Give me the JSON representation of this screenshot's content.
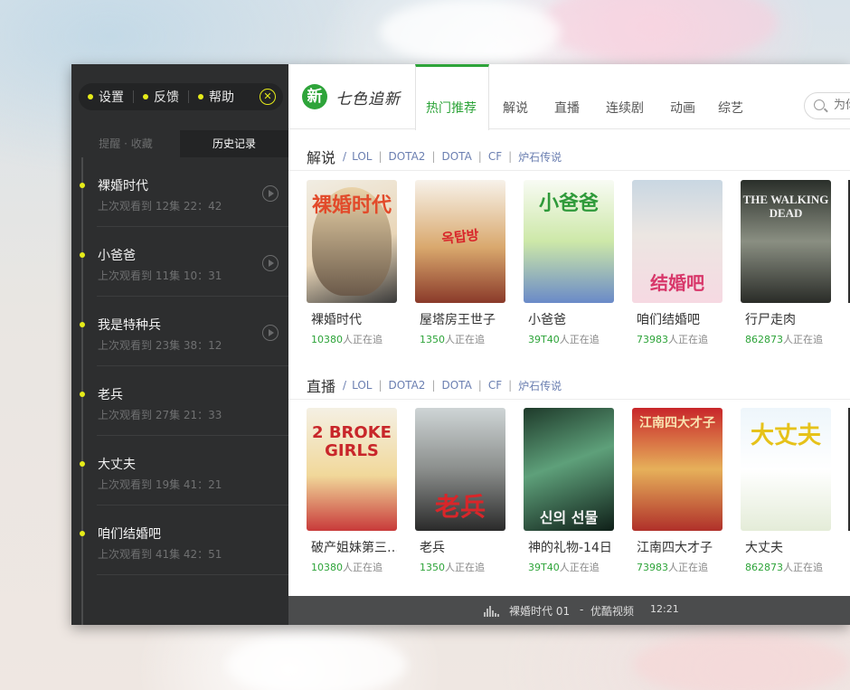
{
  "sidebar": {
    "top_links": [
      {
        "label": "设置"
      },
      {
        "label": "反馈"
      },
      {
        "label": "帮助"
      }
    ],
    "tabs": [
      {
        "label": "提醒 · 收藏"
      },
      {
        "label": "历史记录"
      }
    ],
    "history": [
      {
        "title": "裸婚时代",
        "sub": "上次观看到 12集 22：42"
      },
      {
        "title": "小爸爸",
        "sub": "上次观看到 11集 10：31"
      },
      {
        "title": "我是特种兵",
        "sub": "上次观看到 23集 38：12"
      },
      {
        "title": "老兵",
        "sub": "上次观看到 27集 21：33"
      },
      {
        "title": "大丈夫",
        "sub": "上次观看到 19集 41：21"
      },
      {
        "title": "咱们结婚吧",
        "sub": "上次观看到 41集 42：51"
      }
    ]
  },
  "header": {
    "logo_badge": "新",
    "logo_text": "七色追新",
    "nav": [
      "热门推荐",
      "解说",
      "直播",
      "连续剧",
      "动画",
      "综艺"
    ],
    "search_placeholder": "为你"
  },
  "sections": [
    {
      "title": "解说",
      "slash": "/",
      "links": [
        "LOL",
        "DOTA2",
        "DOTA",
        "CF",
        "炉石传说"
      ],
      "cards": [
        {
          "title": "裸婚时代",
          "count": "10380",
          "suffix": "人正在追",
          "poster_text": "裸婚时代"
        },
        {
          "title": "屋塔房王世子",
          "count": "1350",
          "suffix": "人正在追",
          "poster_text": "옥탑방"
        },
        {
          "title": "小爸爸",
          "count": "39T40",
          "suffix": "人正在追",
          "poster_text": "小爸爸"
        },
        {
          "title": "咱们结婚吧",
          "count": "73983",
          "suffix": "人正在追",
          "poster_text": "结婚吧"
        },
        {
          "title": "行尸走肉",
          "count": "862873",
          "suffix": "人正在追",
          "poster_text": "THE WALKING DEAD"
        }
      ]
    },
    {
      "title": "直播",
      "slash": "/",
      "links": [
        "LOL",
        "DOTA2",
        "DOTA",
        "CF",
        "炉石传说"
      ],
      "cards": [
        {
          "title": "破产姐妹第三…",
          "count": "10380",
          "suffix": "人正在追",
          "poster_text": "2 BROKE GIRLS"
        },
        {
          "title": "老兵",
          "count": "1350",
          "suffix": "人正在追",
          "poster_text": "老兵"
        },
        {
          "title": "神的礼物-14日",
          "count": "39T40",
          "suffix": "人正在追",
          "poster_text": "신의 선물"
        },
        {
          "title": "江南四大才子",
          "count": "73983",
          "suffix": "人正在追",
          "poster_text": "江南四大才子"
        },
        {
          "title": "大丈夫",
          "count": "862873",
          "suffix": "人正在追",
          "poster_text": "大丈夫"
        }
      ]
    }
  ],
  "player": {
    "now_playing": "裸婚时代 01",
    "separator": "-",
    "source": "优酷视频",
    "time": "12:21"
  },
  "colors": {
    "accent": "#2ea43a",
    "highlight": "#e6ec19",
    "link": "#6b7fb1"
  }
}
